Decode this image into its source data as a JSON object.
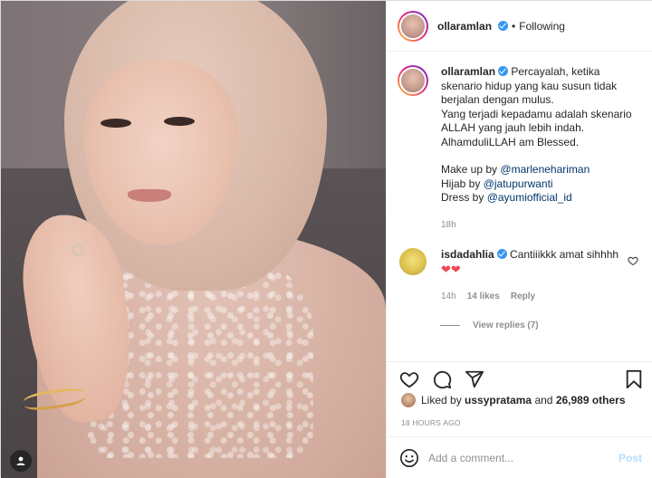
{
  "post": {
    "username": "ollaramlan",
    "follow_status": "Following",
    "separator": "•",
    "caption_lines": [
      "Percayalah, ketika skenario hidup yang kau susun tidak berjalan dengan mulus.",
      "Yang terjadi kepadamu adalah skenario ALLAH yang jauh lebih indah.",
      "AlhamduliLLAH am Blessed."
    ],
    "credits": [
      {
        "label": "Make up by",
        "mention": "@marlenehariman"
      },
      {
        "label": "Hijab by",
        "mention": "@jatupurwanti"
      },
      {
        "label": "Dress by",
        "mention": "@ayumiofficial_id"
      }
    ],
    "caption_time": "18h",
    "liked_by_prefix": "Liked by",
    "liked_by_user": "ussypratama",
    "liked_by_and": "and",
    "liked_by_count": "26,989 others",
    "date": "18 HOURS AGO"
  },
  "comment": {
    "username": "isdadahlia",
    "text": "Cantiiikkk amat sihhhh",
    "hearts": "❤❤",
    "time": "14h",
    "likes": "14 likes",
    "reply": "Reply",
    "view_replies": "View replies (7)"
  },
  "add_comment": {
    "placeholder": "Add a comment...",
    "post_label": "Post"
  },
  "colors": {
    "verified": "#3897f0",
    "mention": "#00376b",
    "heart": "#ed4956",
    "post_disabled": "#b2dffc"
  },
  "icons": {
    "like": "heart-outline-icon",
    "comment": "speech-bubble-icon",
    "share": "paper-plane-icon",
    "save": "bookmark-icon",
    "emoji": "smiley-icon",
    "tagged": "user-tag-icon"
  }
}
